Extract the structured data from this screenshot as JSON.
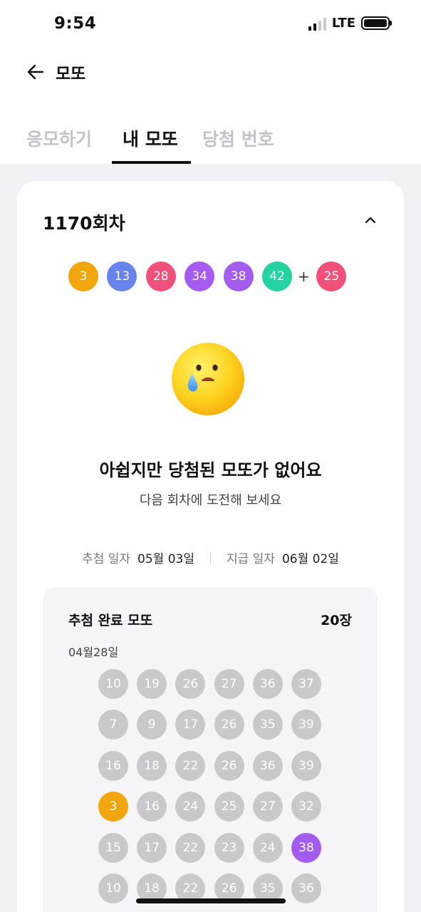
{
  "status": {
    "time": "9:54",
    "network": "LTE"
  },
  "header": {
    "title": "모또"
  },
  "tabs": [
    {
      "label": "응모하기",
      "active": false
    },
    {
      "label": "내 모또",
      "active": true
    },
    {
      "label": "당첨 번호",
      "active": false
    }
  ],
  "round": {
    "title": "1170회차",
    "winning_numbers": [
      {
        "n": "3",
        "color": "#f2a60d"
      },
      {
        "n": "13",
        "color": "#6783ee"
      },
      {
        "n": "28",
        "color": "#f0507a"
      },
      {
        "n": "34",
        "color": "#a45cee"
      },
      {
        "n": "38",
        "color": "#a45cee"
      },
      {
        "n": "42",
        "color": "#24d3a0"
      }
    ],
    "plus": "+",
    "bonus": {
      "n": "25",
      "color": "#f0507a"
    }
  },
  "result": {
    "message": "아쉽지만 당첨된 모또가 없어요",
    "sub": "다음 회차에 도전해 보세요"
  },
  "dates": {
    "draw_label": "추첨 일자",
    "draw_value": "05월 03일",
    "pay_label": "지급 일자",
    "pay_value": "06월 02일"
  },
  "tickets": {
    "title": "추첨 완료 모또",
    "count": "20장",
    "date": "04월28일",
    "rows": [
      [
        "10",
        "19",
        "26",
        "27",
        "36",
        "37"
      ],
      [
        "7",
        "9",
        "17",
        "26",
        "35",
        "39"
      ],
      [
        "16",
        "18",
        "22",
        "26",
        "36",
        "39"
      ],
      [
        "3",
        "16",
        "24",
        "25",
        "27",
        "32"
      ],
      [
        "15",
        "17",
        "22",
        "23",
        "24",
        "38"
      ],
      [
        "10",
        "18",
        "22",
        "26",
        "35",
        "36"
      ]
    ],
    "matched": {
      "3": "#f2a60d",
      "38": "#a45cee"
    },
    "default_color": "#c9c9cc"
  }
}
